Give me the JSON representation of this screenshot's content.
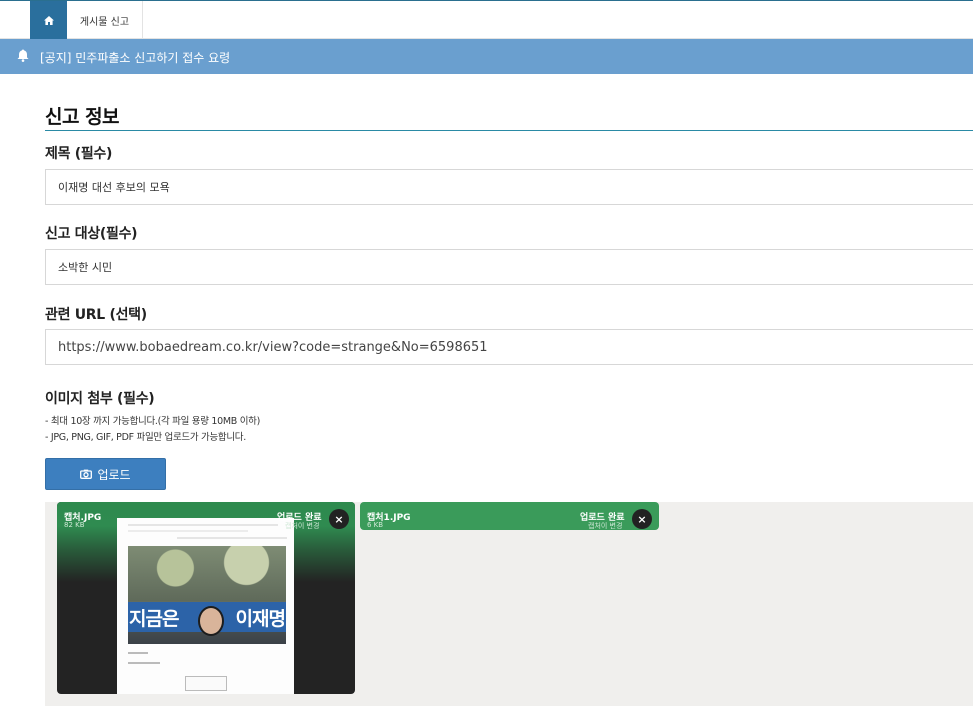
{
  "topnav": {
    "home_icon": "home-icon",
    "tab_label": "게시물 신고"
  },
  "notice": {
    "icon": "bell-icon",
    "text": "[공지] 민주파출소 신고하기 접수 요령"
  },
  "form": {
    "section_title": "신고 정보",
    "title_label": "제목 (필수)",
    "title_value": "이재명 대선 후보의 모욕",
    "target_label": "신고 대상(필수)",
    "target_value": "소박한 시민",
    "url_label": "관련 URL (선택)",
    "url_value": "https://www.bobaedream.co.kr/view?code=strange&No=6598651",
    "image_label": "이미지 첨부 (필수)",
    "image_note1": "- 최대 10장 까지 가능합니다.(각 파일 용량 10MB 이하)",
    "image_note2": "- JPG, PNG, GIF, PDF 파일만 업로드가 가능합니다.",
    "upload_button": "업로드",
    "upload_icon": "camera-icon"
  },
  "attachments": [
    {
      "filename": "캡처.JPG",
      "size": "82 KB",
      "status": "업로드 완료",
      "change": "캡처이 변경"
    },
    {
      "filename": "캡처1.JPG",
      "size": "6 KB",
      "status": "업로드 완료",
      "change": "캡처이 변경"
    }
  ],
  "preview": {
    "banner_left": "지금은",
    "banner_right": "이재명"
  },
  "colors": {
    "primary": "#2a6f9d",
    "notice_bar": "#6a9fcf",
    "upload_button": "#3d7fbf",
    "attachment_green": "#3a9b5a",
    "section_line": "#2a8aa5"
  }
}
